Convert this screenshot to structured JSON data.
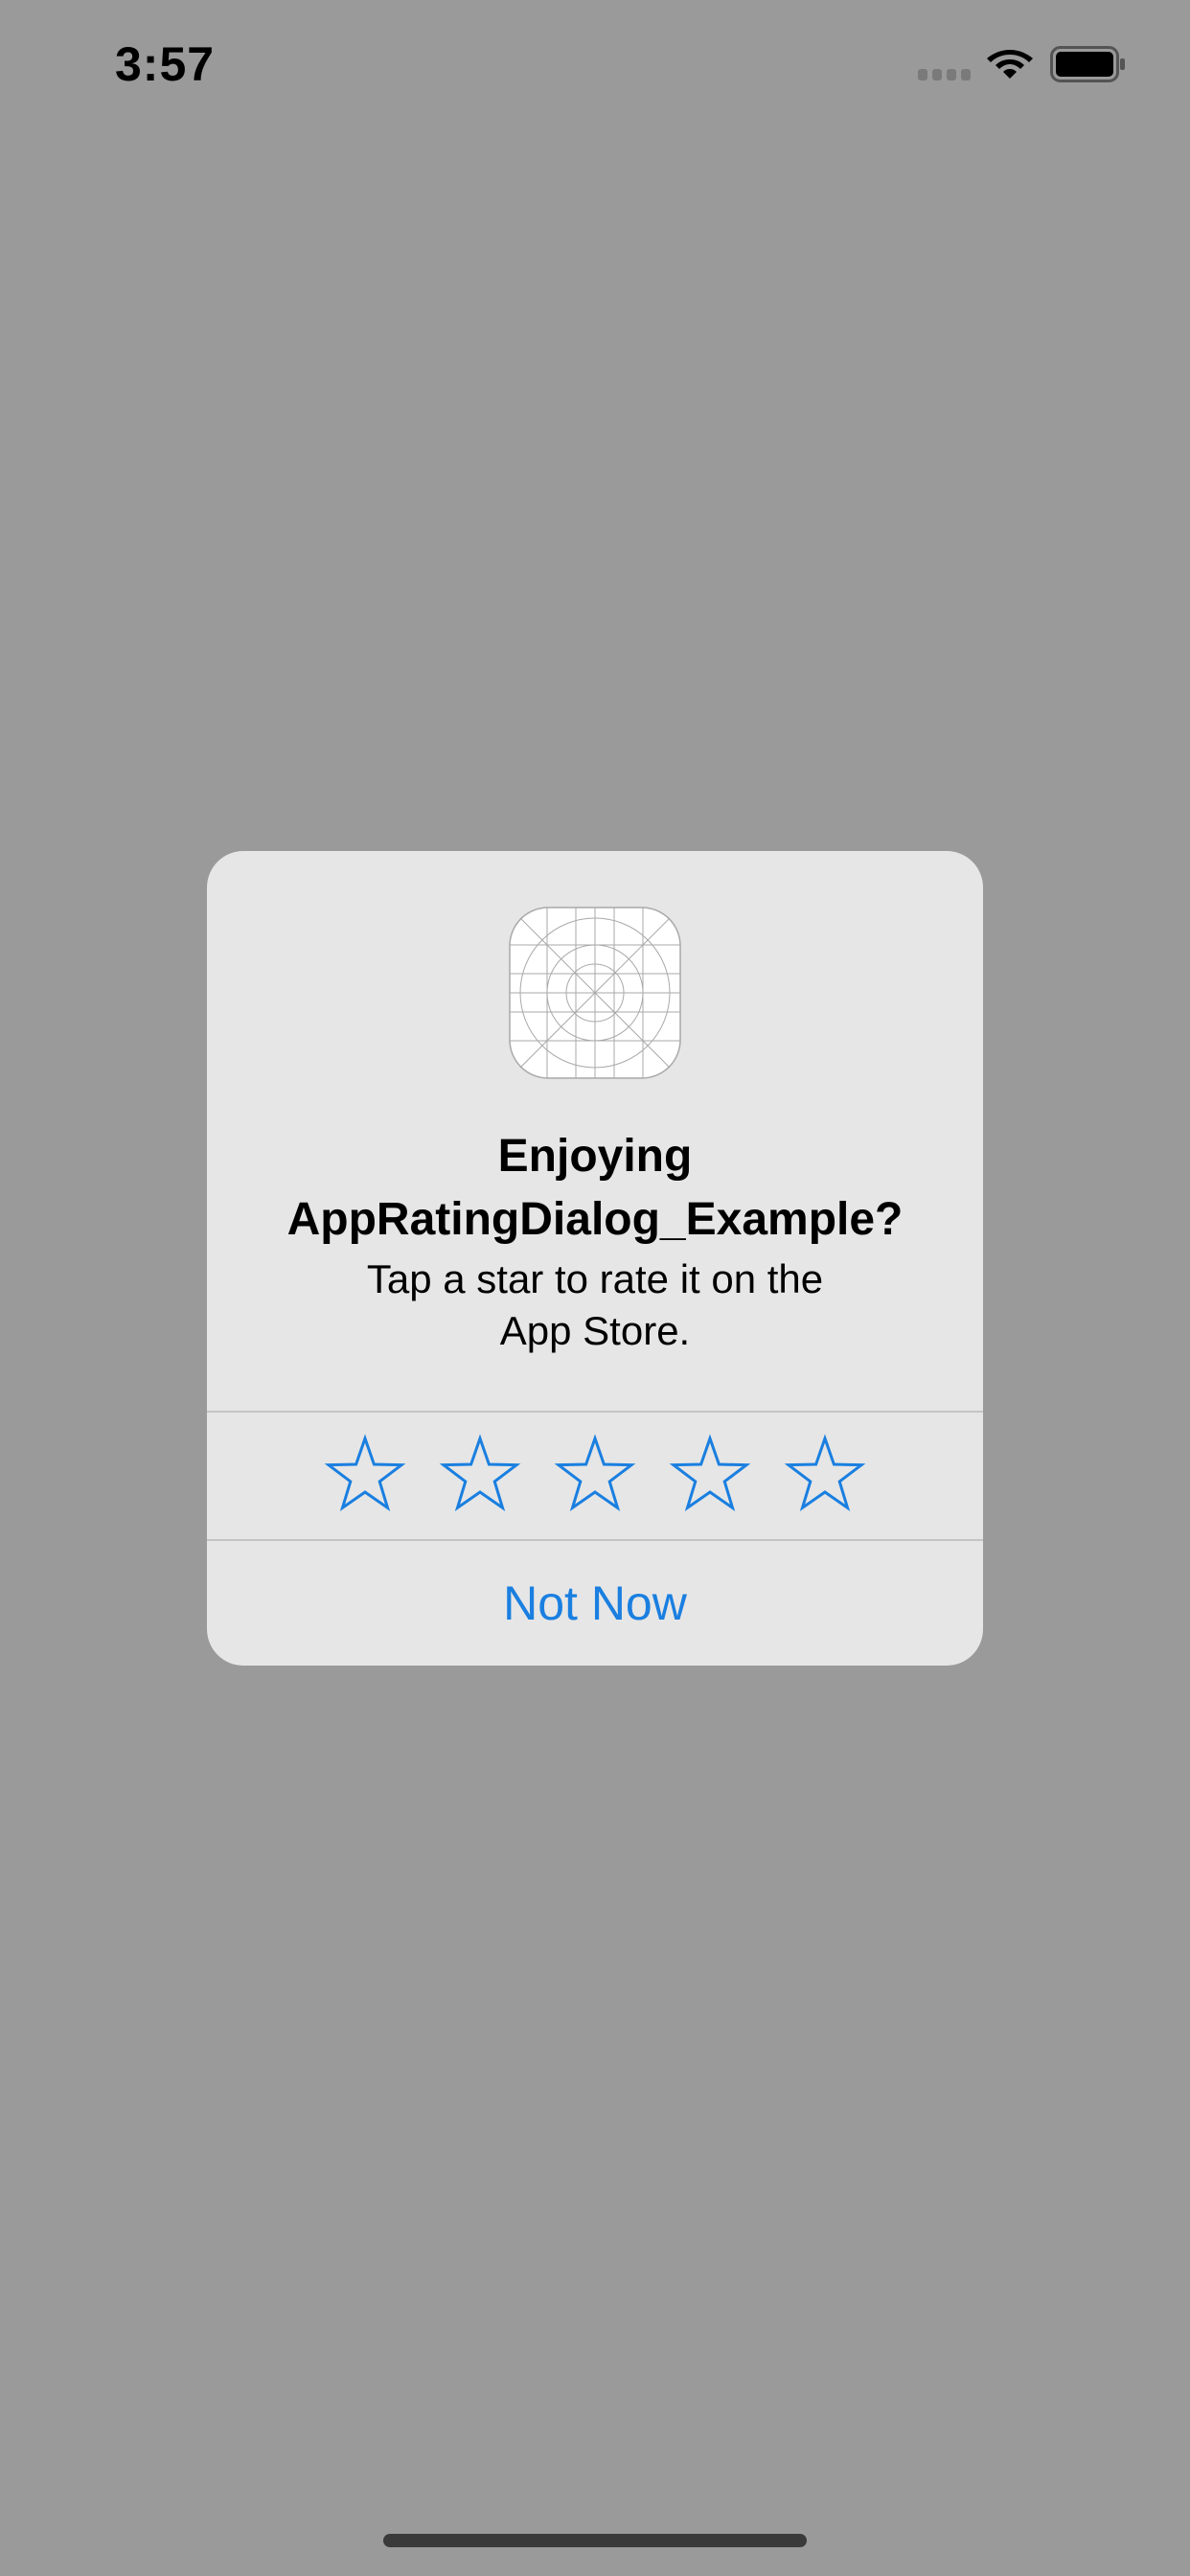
{
  "status_bar": {
    "time": "3:57"
  },
  "dialog": {
    "title_line1": "Enjoying",
    "title_line2": "AppRatingDialog_Example?",
    "message_line1": "Tap a star to rate it on the",
    "message_line2": "App Store.",
    "stars": [
      {
        "label": "1 star"
      },
      {
        "label": "2 stars"
      },
      {
        "label": "3 stars"
      },
      {
        "label": "4 stars"
      },
      {
        "label": "5 stars"
      }
    ],
    "rating": 0,
    "max_rating": 5,
    "dismiss_label": "Not Now"
  },
  "colors": {
    "background_dim": "#9a9a9a",
    "dialog_bg": "#e6e6e6",
    "accent": "#1a7fe0",
    "separator": "#c4c4c4"
  },
  "icons": {
    "app_icon": "app-icon-placeholder-grid",
    "star": "star-outline-icon",
    "wifi": "wifi-icon",
    "battery": "battery-icon",
    "signal": "cellular-signal-icon"
  }
}
